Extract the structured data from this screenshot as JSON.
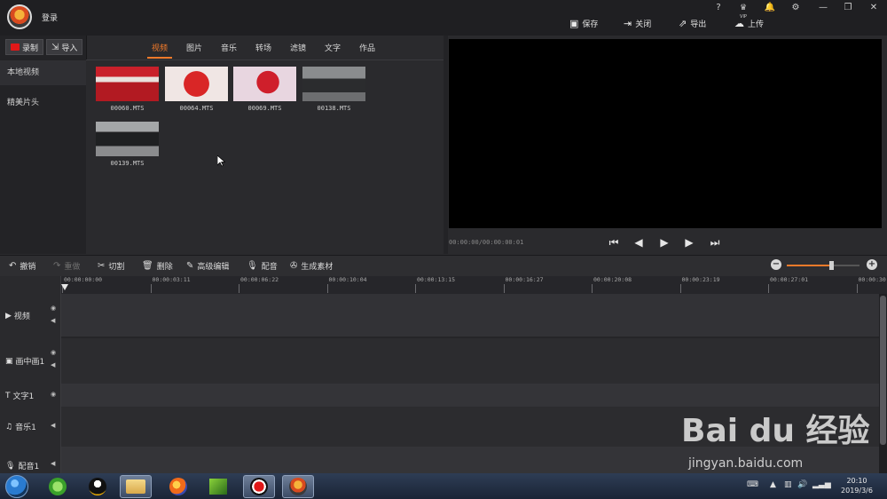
{
  "header": {
    "login": "登录",
    "window_buttons": [
      "?",
      "♛",
      "🔔",
      "⚙",
      "—",
      "❐",
      "✕"
    ],
    "vip_label": "VIP",
    "actions": [
      {
        "icon": "save-icon",
        "label": "保存"
      },
      {
        "icon": "exit-icon",
        "label": "关闭"
      },
      {
        "icon": "export-icon",
        "label": "导出"
      },
      {
        "icon": "upload-icon",
        "label": "上传"
      }
    ]
  },
  "left": {
    "record_label": "录制",
    "import_label": "导入",
    "nav": [
      "本地视频",
      "精美片头"
    ]
  },
  "tabs": [
    {
      "label": "视频",
      "active": true
    },
    {
      "label": "图片",
      "active": false
    },
    {
      "label": "音乐",
      "active": false
    },
    {
      "label": "转场",
      "active": false
    },
    {
      "label": "滤镜",
      "active": false
    },
    {
      "label": "文字",
      "active": false
    },
    {
      "label": "作品",
      "active": false
    }
  ],
  "media": [
    {
      "name": "00060.MTS"
    },
    {
      "name": "00064.MTS"
    },
    {
      "name": "00069.MTS"
    },
    {
      "name": "00138.MTS"
    },
    {
      "name": "00139.MTS"
    }
  ],
  "preview": {
    "timecode": "00:00:00/00:00:00:01"
  },
  "toolbar": [
    {
      "icon": "undo-icon",
      "label": "撤销",
      "enabled": true
    },
    {
      "icon": "redo-icon",
      "label": "重做",
      "enabled": false
    },
    {
      "icon": "scissors-icon",
      "label": "切割",
      "enabled": true
    },
    {
      "icon": "trash-icon",
      "label": "删除",
      "enabled": true
    },
    {
      "icon": "pencil-icon",
      "label": "高级编辑",
      "enabled": true
    },
    {
      "icon": "mic-icon",
      "label": "配音",
      "enabled": true
    },
    {
      "icon": "film-icon",
      "label": "生成素材",
      "enabled": true
    }
  ],
  "zoom": {
    "level": 0.6
  },
  "ruler": [
    "00:00:00:00",
    "00:00:03:11",
    "00:00:06:22",
    "00:00:10:04",
    "00:00:13:15",
    "00:00:16:27",
    "00:00:20:08",
    "00:00:23:19",
    "00:00:27:01",
    "00:00:30:"
  ],
  "tracks": [
    {
      "icon": "video-icon",
      "label": "视频"
    },
    {
      "icon": "pip-icon",
      "label": "画中画1"
    },
    {
      "icon": "text-icon",
      "label": "文字1"
    },
    {
      "icon": "music-icon",
      "label": "音乐1"
    },
    {
      "icon": "mic-icon",
      "label": "配音1"
    }
  ],
  "taskbar": {
    "time": "20:10",
    "date": "2019/3/6"
  },
  "watermark": {
    "line1": "Bai du 经验",
    "line2": "jingyan.baidu.com"
  },
  "colors": {
    "accent": "#f07a2a",
    "record": "#e01818"
  }
}
